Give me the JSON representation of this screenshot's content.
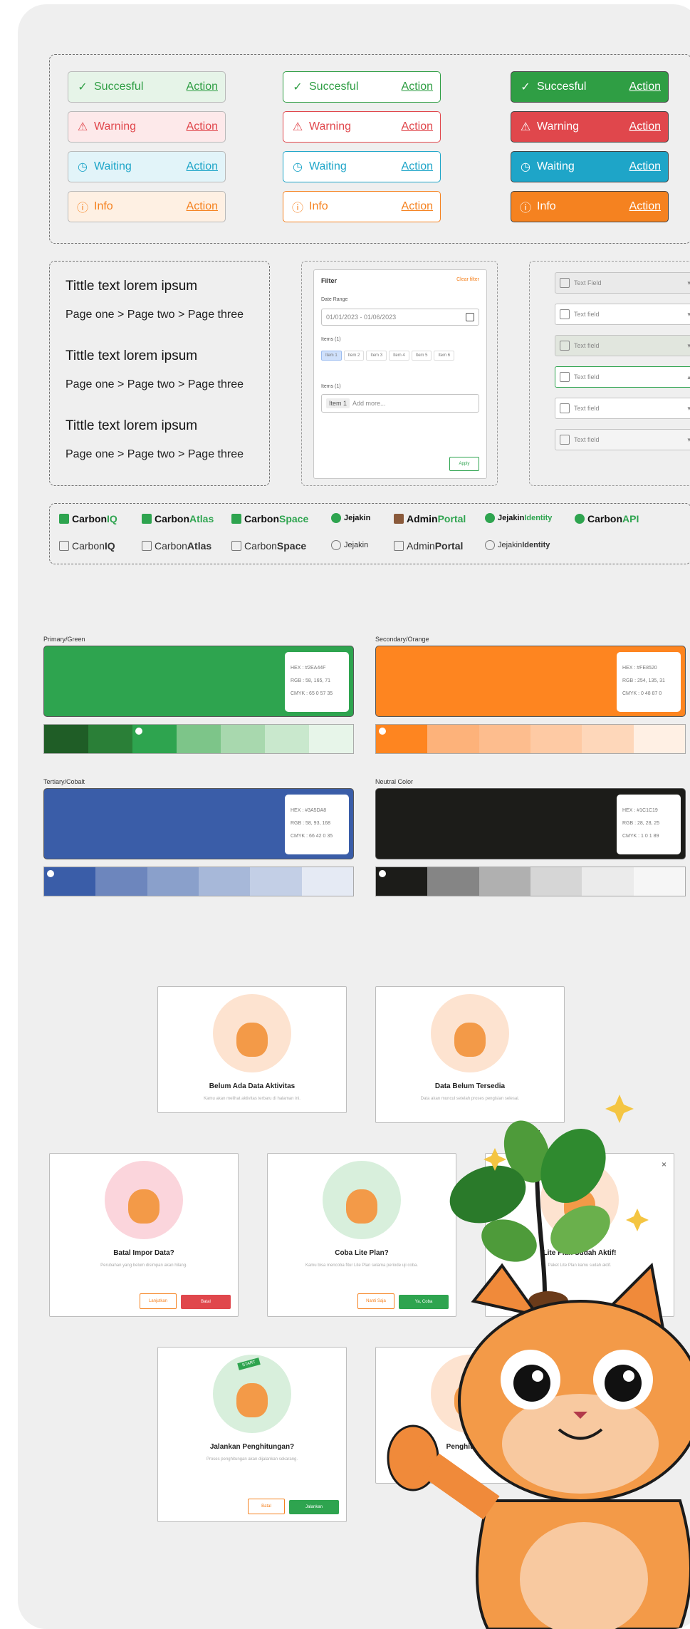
{
  "toasts": {
    "action_label": "Action",
    "items": [
      {
        "label": "Succesful",
        "icon": "check-circle-icon",
        "color": "#2f9e44",
        "soft_bg": "#e6f4e8"
      },
      {
        "label": "Warning",
        "icon": "warning-triangle-icon",
        "color": "#e0474c",
        "soft_bg": "#fde9ea"
      },
      {
        "label": "Waiting",
        "icon": "clock-icon",
        "color": "#1ea5c8",
        "soft_bg": "#e2f4f9"
      },
      {
        "label": "Info",
        "icon": "info-circle-icon",
        "color": "#f58220",
        "soft_bg": "#fef0e3"
      }
    ]
  },
  "breadcrumbs": {
    "blocks": [
      {
        "title": "Tittle text lorem ipsum",
        "crumbs": [
          "Page one",
          "Page two",
          "Page three"
        ],
        "active_index": 0
      },
      {
        "title": "Tittle text lorem ipsum",
        "crumbs": [
          "Page one",
          "Page two",
          "Page three"
        ],
        "active_index": 1
      },
      {
        "title": "Tittle text lorem ipsum",
        "crumbs": [
          "Page one",
          "Page two",
          "Page three"
        ],
        "active_index": 2
      }
    ],
    "separator": ">"
  },
  "filter": {
    "title": "Filter",
    "clear": "Clear filter",
    "date_label": "Date Range",
    "date_value": "01/01/2023 - 01/06/2023",
    "items_label": "Items (1)",
    "chips": [
      "Item 1",
      "Item 2",
      "Item 3",
      "Item 4",
      "Item 5",
      "Item 6"
    ],
    "items2_label": "Items (1)",
    "chip_input": "Item 1",
    "chip_placeholder": "Add more...",
    "apply": "Apply"
  },
  "dropdowns": {
    "disabled_placeholder": "Text Field",
    "items": [
      "Text field",
      "Text field",
      "Text field",
      "Text field",
      "Text field"
    ]
  },
  "logos": {
    "row_color": [
      {
        "a": "Carbon",
        "b": "IQ",
        "icon": "carbon-iq-icon"
      },
      {
        "a": "Carbon",
        "b": "Atlas",
        "icon": "carbon-atlas-icon"
      },
      {
        "a": "Carbon",
        "b": "Space",
        "icon": "carbon-space-icon"
      },
      {
        "a": "Jejakin",
        "b": "",
        "icon": "jejakin-leaf-icon"
      },
      {
        "a": "Admin",
        "b": "Portal",
        "icon": "admin-portal-icon"
      },
      {
        "a": "Jejakin",
        "b": "Identity",
        "icon": "jejakin-identity-icon"
      },
      {
        "a": "Carbon",
        "b": "API",
        "icon": "carbon-api-icon"
      }
    ],
    "row_gray": [
      {
        "a": "Carbon",
        "b": "IQ"
      },
      {
        "a": "Carbon",
        "b": "Atlas"
      },
      {
        "a": "Carbon",
        "b": "Space"
      },
      {
        "a": "Jejakin",
        "b": ""
      },
      {
        "a": "Admin",
        "b": "Portal"
      },
      {
        "a": "Jejakin",
        "b": "Identity"
      }
    ]
  },
  "palettes": [
    {
      "title": "Primary/Green",
      "main": "#2EA44F",
      "hex": "HEX : #2EA44F",
      "rgb": "RGB : 58, 165, 71",
      "cmyk": "CMYK : 65 0 57 35",
      "shades": [
        "#1f5d26",
        "#2a7f37",
        "#2ea44f",
        "#7dc589",
        "#a8d8ae",
        "#c9e8cd",
        "#e7f5e9"
      ],
      "dot_index": 2
    },
    {
      "title": "Secondary/Orange",
      "main": "#FE8520",
      "hex": "HEX : #FE8520",
      "rgb": "RGB : 254, 135, 31",
      "cmyk": "CMYK : 0 48 87 0",
      "shades": [
        "#fe8520",
        "#fdb27a",
        "#fdbd8e",
        "#fecaa4",
        "#fed7ba",
        "#fff0e4"
      ],
      "dot_index": 0
    },
    {
      "title": "Tertiary/Cobalt",
      "main": "#3A5DA8",
      "hex": "HEX : #3A5DA8",
      "rgb": "RGB : 58, 93, 168",
      "cmyk": "CMYK : 66 42 0 35",
      "shades": [
        "#3a5da8",
        "#6d86bd",
        "#8aa0cb",
        "#a7b8d9",
        "#c3cfe6",
        "#e5eaf4"
      ],
      "dot_index": 0
    },
    {
      "title": "Neutral Color",
      "main": "#1C1C19",
      "hex": "HEX : #1C1C19",
      "rgb": "RGB : 28, 28, 25",
      "cmyk": "CMYK : 1 0 1 89",
      "shades": [
        "#1c1c19",
        "#858585",
        "#b0b0b0",
        "#d6d6d6",
        "#ebebeb",
        "#f6f6f6"
      ],
      "dot_index": 0
    }
  ],
  "empty_states": [
    {
      "title": "Belum Ada Data Aktivitas",
      "sub": "Kamu akan melihat aktivitas terbaru di halaman ini.",
      "ring": "#fde3d0"
    },
    {
      "title": "Data Belum Tersedia",
      "sub": "Data akan muncul setelah proses pengisian selesai.",
      "ring": "#fde3d0"
    },
    {
      "title": "Batal Impor Data?",
      "sub": "Perubahan yang belum disimpan akan hilang.",
      "ring": "#fbd5dc",
      "btn1": "Lanjutkan",
      "btn2": "Batal"
    },
    {
      "title": "Coba Lite Plan?",
      "sub": "Kamu bisa mencoba fitur Lite Plan selama periode uji coba.",
      "ring": "#d8efdc",
      "btn1": "Nanti Saja",
      "btn2": "Ya, Coba"
    },
    {
      "title": "Lite Plan Sudah Aktif!",
      "sub": "Paket Lite Plan kamu sudah aktif.",
      "ring": "#fde3d0"
    },
    {
      "title": "Jalankan Penghitungan?",
      "sub": "Proses penghitungan akan dijalankan sekarang.",
      "ring": "#d8efdc",
      "btn1": "Batal",
      "btn2": "Jalankan",
      "flag": "START"
    },
    {
      "title": "Penghitungan",
      "sub": "",
      "ring": "#fde3d0"
    }
  ],
  "colors": {
    "green": "#2ea44f",
    "orange": "#f58220",
    "red": "#e0474c"
  }
}
